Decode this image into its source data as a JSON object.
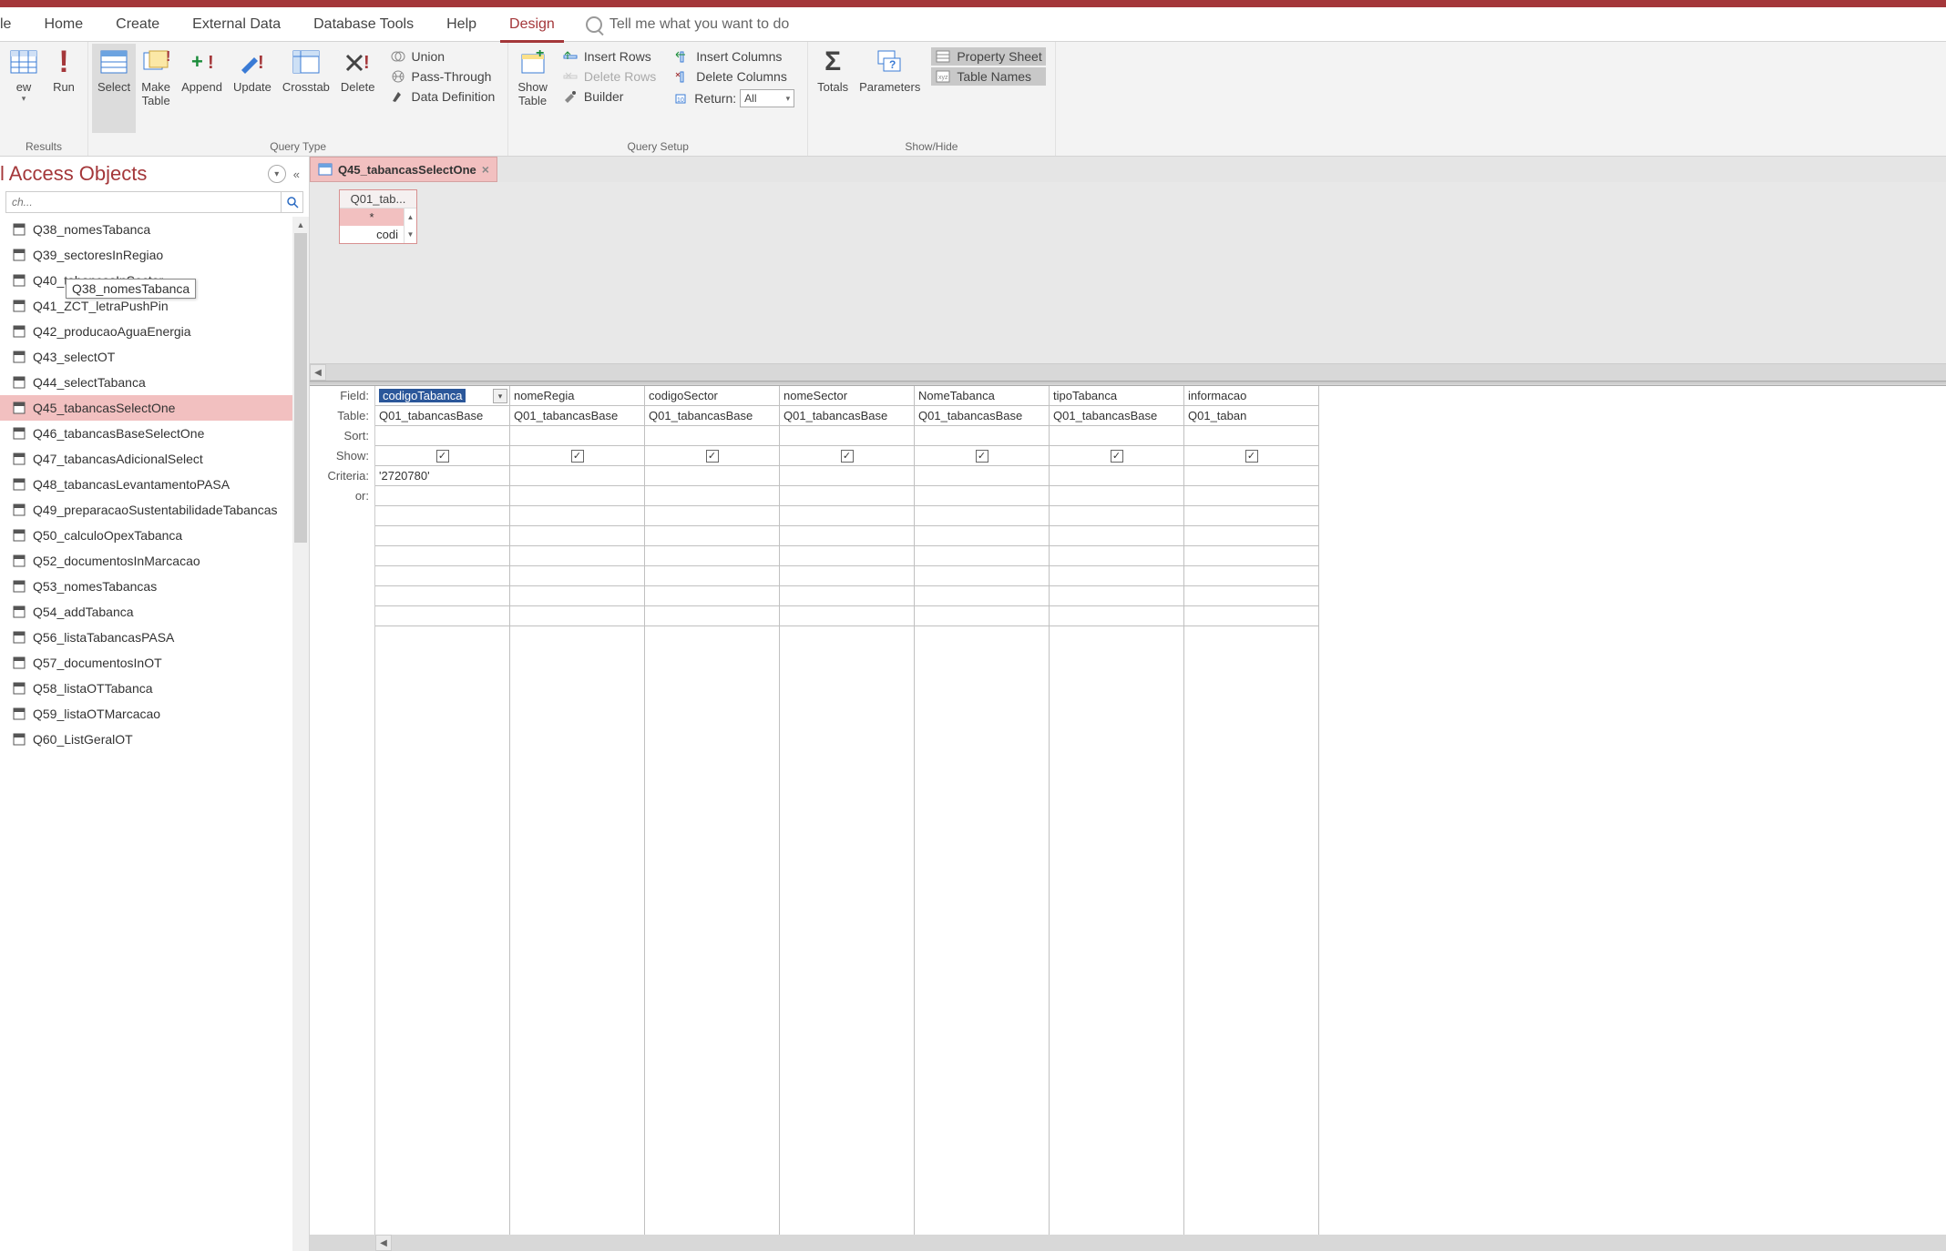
{
  "ribbon": {
    "tabs": [
      "le",
      "Home",
      "Create",
      "External Data",
      "Database Tools",
      "Help",
      "Design"
    ],
    "active_tab": 6,
    "tellme": "Tell me what you want to do",
    "groups": {
      "results": {
        "label": "Results",
        "view": "ew",
        "run": "Run"
      },
      "query_type": {
        "label": "Query Type",
        "select": "Select",
        "make_table": "Make\nTable",
        "append": "Append",
        "update": "Update",
        "crosstab": "Crosstab",
        "delete": "Delete",
        "union": "Union",
        "passthrough": "Pass-Through",
        "datadef": "Data Definition"
      },
      "query_setup": {
        "label": "Query Setup",
        "show_table": "Show\nTable",
        "insert_rows": "Insert Rows",
        "delete_rows": "Delete Rows",
        "builder": "Builder",
        "insert_cols": "Insert Columns",
        "delete_cols": "Delete Columns",
        "return_label": "Return:",
        "return_value": "All"
      },
      "showhide": {
        "label": "Show/Hide",
        "totals": "Totals",
        "parameters": "Parameters",
        "property_sheet": "Property Sheet",
        "table_names": "Table Names"
      }
    }
  },
  "nav": {
    "title": "l Access Objects",
    "search_placeholder": "ch...",
    "items": [
      "Q38_nomesTabanca",
      "Q39_sectoresInRegiao",
      "Q40_tabancasInSector",
      "Q41_ZCT_letraPushPin",
      "Q42_producaoAguaEnergia",
      "Q43_selectOT",
      "Q44_selectTabanca",
      "Q45_tabancasSelectOne",
      "Q46_tabancasBaseSelectOne",
      "Q47_tabancasAdicionalSelect",
      "Q48_tabancasLevantamentoPASA",
      "Q49_preparacaoSustentabilidadeTabancas",
      "Q50_calculoOpexTabanca",
      "Q52_documentosInMarcacao",
      "Q53_nomesTabancas",
      "Q54_addTabanca",
      "Q56_listaTabancasPASA",
      "Q57_documentosInOT",
      "Q58_listaOTTabanca",
      "Q59_listaOTMarcacao",
      "Q60_ListGeralOT"
    ],
    "selected_index": 7,
    "tooltip_text": "Q38_nomesTabanca"
  },
  "doc": {
    "tab_title": "Q45_tabancasSelectOne",
    "table_box": {
      "title": "Q01_tab...",
      "asterisk": "*",
      "field": "codi"
    },
    "grid": {
      "row_labels": [
        "Field:",
        "Table:",
        "Sort:",
        "Show:",
        "Criteria:",
        "or:"
      ],
      "columns": [
        {
          "field": "codigoTabanca",
          "table": "Q01_tabancasBase",
          "show": true,
          "criteria": "'2720780'"
        },
        {
          "field": "nomeRegia",
          "table": "Q01_tabancasBase",
          "show": true,
          "criteria": ""
        },
        {
          "field": "codigoSector",
          "table": "Q01_tabancasBase",
          "show": true,
          "criteria": ""
        },
        {
          "field": "nomeSector",
          "table": "Q01_tabancasBase",
          "show": true,
          "criteria": ""
        },
        {
          "field": "NomeTabanca",
          "table": "Q01_tabancasBase",
          "show": true,
          "criteria": ""
        },
        {
          "field": "tipoTabanca",
          "table": "Q01_tabancasBase",
          "show": true,
          "criteria": ""
        },
        {
          "field": "informacao",
          "table": "Q01_taban",
          "show": true,
          "criteria": ""
        }
      ]
    }
  }
}
